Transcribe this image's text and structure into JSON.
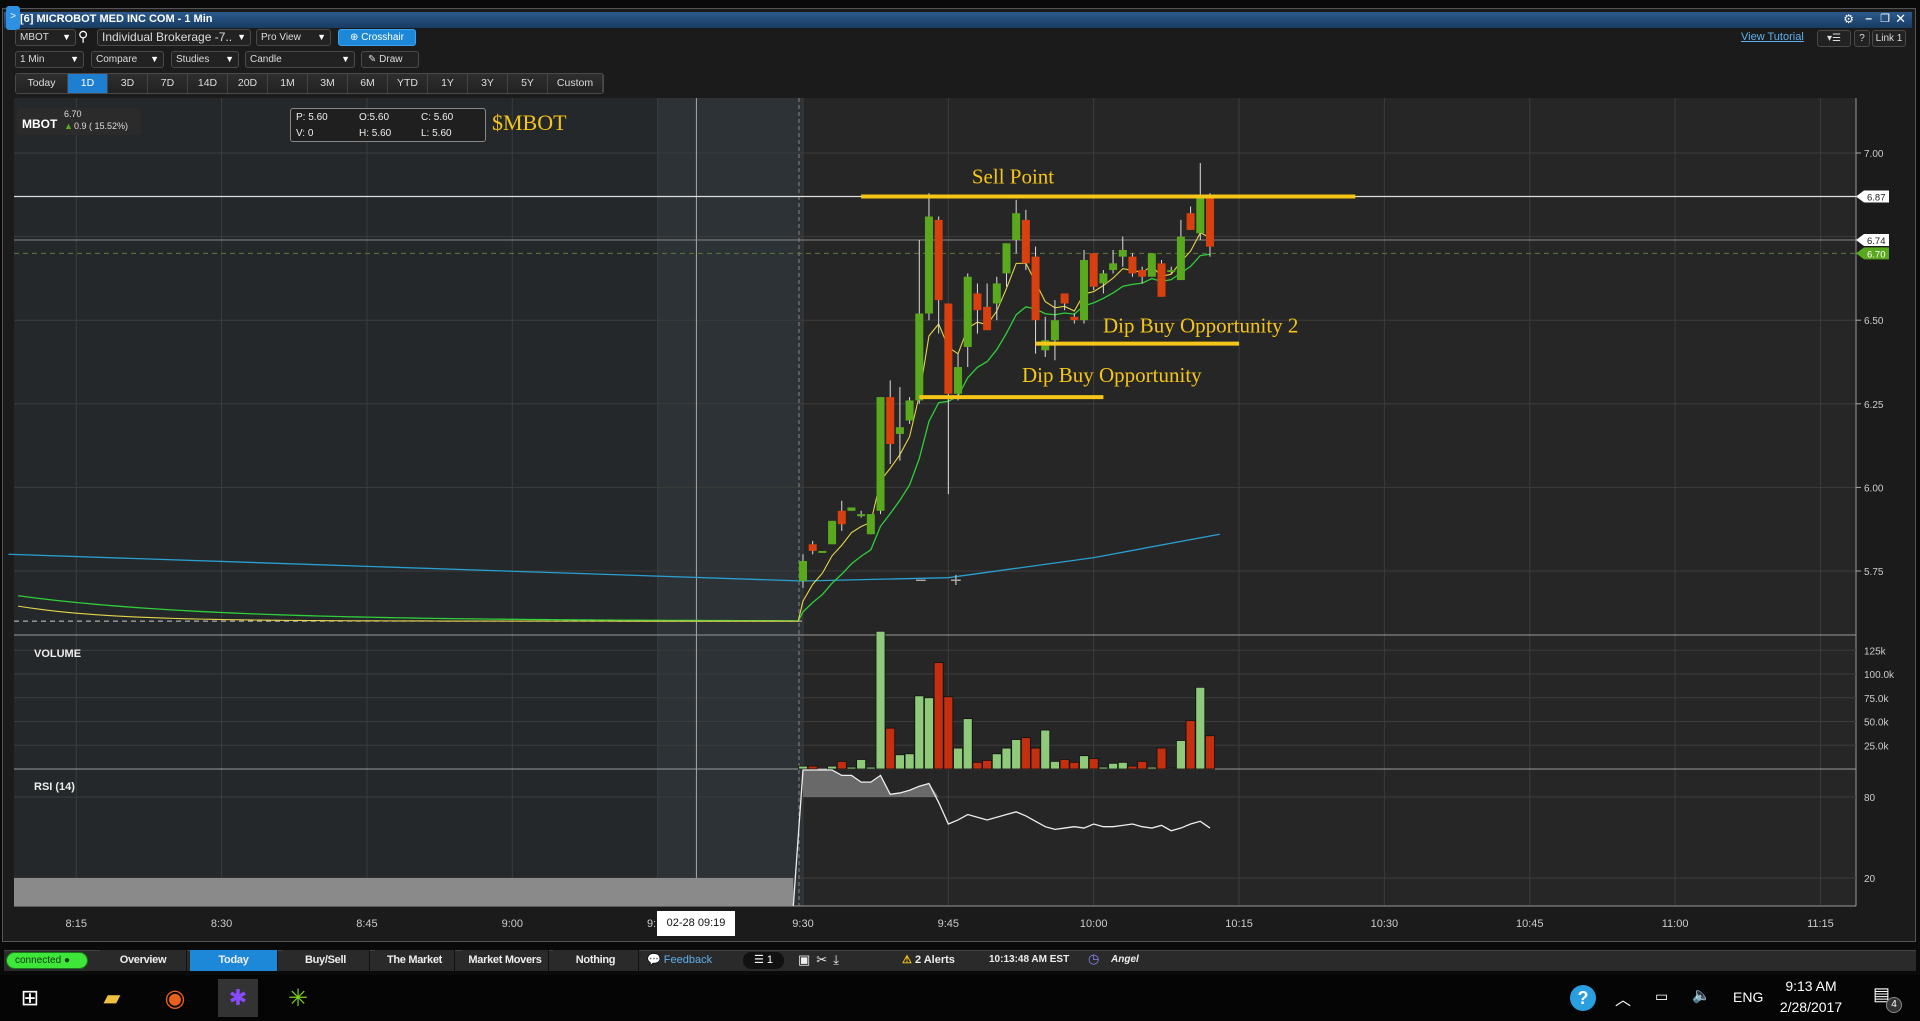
{
  "window": {
    "title": "[6] MICROBOT MED INC COM - 1 Min",
    "side_tab": ">"
  },
  "toolbar": {
    "symbol": "MBOT",
    "account": "Individual Brokerage -7..",
    "view": "Pro View",
    "crosshair": "Crosshair",
    "interval": "1 Min",
    "compare": "Compare",
    "studies": "Studies",
    "chart_type": "Candle",
    "draw": "Draw",
    "view_tutorial": "View Tutorial",
    "help": "?",
    "link": "Link 1",
    "ranges": [
      "Today",
      "1D",
      "3D",
      "7D",
      "14D",
      "20D",
      "1M",
      "3M",
      "6M",
      "YTD",
      "1Y",
      "3Y",
      "5Y",
      "Custom"
    ],
    "selected_range": "1D"
  },
  "quote": {
    "symbol": "MBOT",
    "last": "6.70",
    "change": "0.9 ( 15.52%)"
  },
  "ohlc_box": {
    "p": "P: 5.60",
    "o": "O:5.60",
    "c": "C: 5.60",
    "v": "V: 0",
    "h": "H: 5.60",
    "l": "L: 5.60"
  },
  "chart_data": {
    "type": "candlestick",
    "title": "$MBOT",
    "start_time": "09:30",
    "candles": [
      [
        5.72,
        5.8,
        5.7,
        5.78
      ],
      [
        5.83,
        5.84,
        5.8,
        5.81
      ],
      [
        5.81,
        5.81,
        5.81,
        5.81
      ],
      [
        5.83,
        5.9,
        5.83,
        5.9
      ],
      [
        5.93,
        5.96,
        5.87,
        5.89
      ],
      [
        5.93,
        5.94,
        5.93,
        5.94
      ],
      [
        5.92,
        5.93,
        5.91,
        5.92
      ],
      [
        5.86,
        5.92,
        5.86,
        5.92
      ],
      [
        5.93,
        6.27,
        5.92,
        6.27
      ],
      [
        6.27,
        6.32,
        6.07,
        6.13
      ],
      [
        6.16,
        6.3,
        6.08,
        6.18
      ],
      [
        6.2,
        6.27,
        6.19,
        6.26
      ],
      [
        6.26,
        6.74,
        6.25,
        6.52
      ],
      [
        6.52,
        6.88,
        6.5,
        6.81
      ],
      [
        6.8,
        6.81,
        6.46,
        6.56
      ],
      [
        6.55,
        6.55,
        5.98,
        6.28
      ],
      [
        6.28,
        6.4,
        6.26,
        6.36
      ],
      [
        6.42,
        6.64,
        6.36,
        6.63
      ],
      [
        6.58,
        6.61,
        6.46,
        6.53
      ],
      [
        6.54,
        6.61,
        6.49,
        6.47
      ],
      [
        6.55,
        6.63,
        6.5,
        6.61
      ],
      [
        6.64,
        6.73,
        6.6,
        6.73
      ],
      [
        6.74,
        6.86,
        6.7,
        6.82
      ],
      [
        6.8,
        6.83,
        6.65,
        6.67
      ],
      [
        6.69,
        6.72,
        6.4,
        6.5
      ],
      [
        6.41,
        6.51,
        6.39,
        6.44
      ],
      [
        6.44,
        6.56,
        6.38,
        6.5
      ],
      [
        6.58,
        6.58,
        6.53,
        6.55
      ],
      [
        6.51,
        6.52,
        6.49,
        6.5
      ],
      [
        6.5,
        6.71,
        6.49,
        6.68
      ],
      [
        6.7,
        6.7,
        6.59,
        6.6
      ],
      [
        6.61,
        6.65,
        6.58,
        6.64
      ],
      [
        6.65,
        6.71,
        6.64,
        6.67
      ],
      [
        6.69,
        6.75,
        6.66,
        6.71
      ],
      [
        6.69,
        6.7,
        6.63,
        6.64
      ],
      [
        6.65,
        6.66,
        6.61,
        6.63
      ],
      [
        6.63,
        6.7,
        6.63,
        6.7
      ],
      [
        6.67,
        6.68,
        6.57,
        6.57
      ],
      [
        6.65,
        6.66,
        6.64,
        6.65
      ],
      [
        6.62,
        6.8,
        6.62,
        6.75
      ],
      [
        6.82,
        6.84,
        6.77,
        6.77
      ],
      [
        6.76,
        6.97,
        6.74,
        6.87
      ],
      [
        6.87,
        6.88,
        6.69,
        6.72
      ]
    ],
    "volume_k": [
      3,
      3,
      0,
      3,
      8,
      2,
      10,
      2,
      145,
      43,
      15,
      16,
      77,
      75,
      112,
      76,
      22,
      53,
      7,
      9,
      16,
      22,
      31,
      33,
      22,
      41,
      8,
      10,
      7,
      14,
      11,
      2,
      6,
      7,
      3,
      8,
      2,
      22,
      1,
      30,
      51,
      86,
      35
    ],
    "rsi": [
      100,
      100,
      100,
      100,
      96,
      96,
      91,
      91,
      96,
      82,
      83,
      85,
      88,
      90,
      76,
      60,
      63,
      67,
      65,
      63,
      65,
      67,
      69,
      66,
      62,
      58,
      56,
      57,
      58,
      57,
      60,
      58,
      58,
      59,
      60,
      58,
      57,
      59,
      55,
      57,
      60,
      62,
      57
    ],
    "previous_close": 5.6,
    "long_ma": [
      [
        "08:08",
        5.8
      ],
      [
        "09:30",
        5.72
      ],
      [
        "09:45",
        5.73
      ],
      [
        "10:00",
        5.79
      ],
      [
        "10:13",
        5.86
      ]
    ],
    "price_ticks": [
      "7.00",
      "6.50",
      "6.25",
      "6.00",
      "5.75"
    ],
    "price_tags": [
      {
        "label": "6.87",
        "value": 6.87,
        "color": "#ffffff"
      },
      {
        "label": "6.74",
        "value": 6.74,
        "color": "#ffffff"
      },
      {
        "label": "6.70",
        "value": 6.7,
        "color": "#5aa81e"
      }
    ],
    "time_ticks": [
      "8:15",
      "8:30",
      "8:45",
      "9:00",
      "9:15",
      "9:30",
      "9:45",
      "10:00",
      "10:15",
      "10:30",
      "10:45",
      "11:00",
      "11:15"
    ],
    "volume_label": "VOLUME",
    "volume_ticks": [
      "125k",
      "100.0k",
      "75.0k",
      "50.0k",
      "25.0k"
    ],
    "rsi_label": "RSI (14)",
    "rsi_ticks": [
      "80",
      "20"
    ],
    "crosshair_label": "02-28 09:19",
    "annotations": [
      {
        "text": "Sell Point",
        "price": 6.87,
        "from": "09:36",
        "to": "10:27"
      },
      {
        "text": "Dip Buy Opportunity 2",
        "price": 6.43,
        "from": "09:54",
        "to": "10:15"
      },
      {
        "text": "Dip Buy Opportunity",
        "price": 6.27,
        "from": "09:42",
        "to": "10:01"
      }
    ],
    "colors": {
      "up": "#5aa81e",
      "down": "#d9400f",
      "vol_up": "#8fc97a",
      "vol_down": "#c4300f",
      "ema_fast": "#e6d54a",
      "ema_slow": "#2fcf3a",
      "long_ma": "#2a9fd0",
      "annotation": "#f5c518"
    }
  },
  "zoom_controls": {
    "minus": "−",
    "plus": "+"
  },
  "appbar": {
    "status": "connected",
    "tabs": [
      "Overview",
      "Today",
      "Buy/Sell",
      "The Market",
      "Market Movers",
      "Nothing"
    ],
    "selected_tab": "Today",
    "feedback": "Feedback",
    "queue_count": "1",
    "alerts": "2 Alerts",
    "clock": "10:13:48 AM EST",
    "user": "Angel"
  },
  "taskbar": {
    "time": "9:13 AM",
    "date": "2/28/2017",
    "language": "ENG",
    "notifications": "4"
  }
}
